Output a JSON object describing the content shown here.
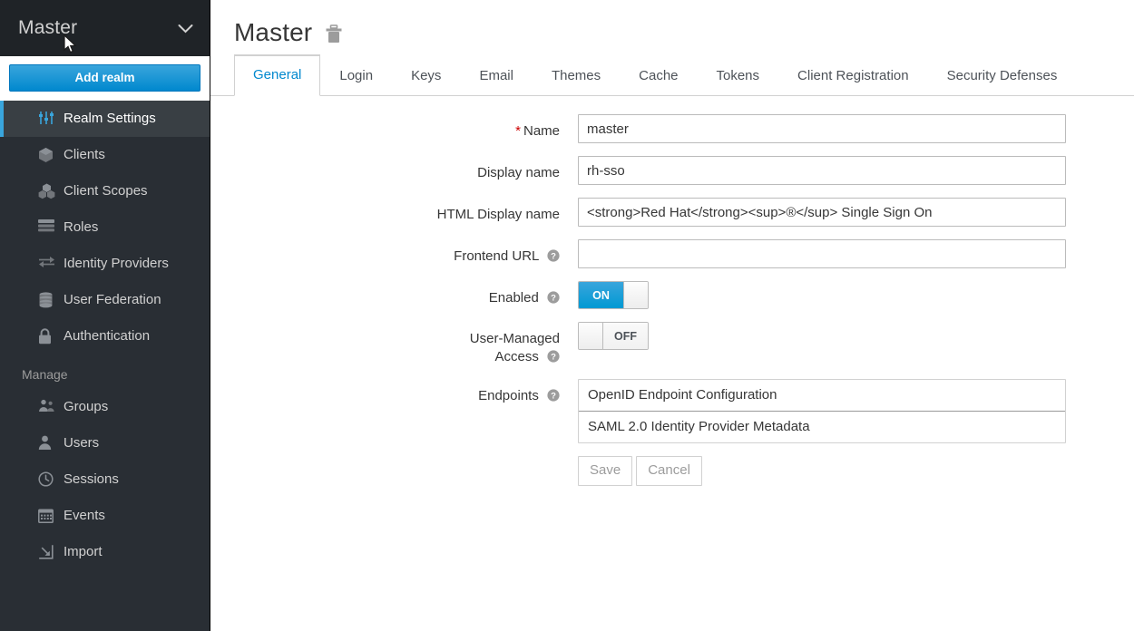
{
  "sidebar": {
    "realm_selector": {
      "label": "Master",
      "chevron_icon": "chevron-down-icon"
    },
    "add_realm_label": "Add realm",
    "items": [
      {
        "label": "Realm Settings",
        "icon": "sliders-icon",
        "active": true
      },
      {
        "label": "Clients",
        "icon": "cube-icon",
        "active": false
      },
      {
        "label": "Client Scopes",
        "icon": "cubes-icon",
        "active": false
      },
      {
        "label": "Roles",
        "icon": "list-rows-icon",
        "active": false
      },
      {
        "label": "Identity Providers",
        "icon": "exchange-arrows-icon",
        "active": false
      },
      {
        "label": "User Federation",
        "icon": "database-icon",
        "active": false
      },
      {
        "label": "Authentication",
        "icon": "lock-icon",
        "active": false
      }
    ],
    "manage_section_label": "Manage",
    "manage_items": [
      {
        "label": "Groups",
        "icon": "users-group-icon"
      },
      {
        "label": "Users",
        "icon": "user-icon"
      },
      {
        "label": "Sessions",
        "icon": "clock-icon"
      },
      {
        "label": "Events",
        "icon": "calendar-icon"
      },
      {
        "label": "Import",
        "icon": "import-arrow-icon"
      }
    ]
  },
  "header": {
    "title": "Master",
    "delete_icon": "trash-icon"
  },
  "tabs": [
    {
      "label": "General",
      "active": true
    },
    {
      "label": "Login",
      "active": false
    },
    {
      "label": "Keys",
      "active": false
    },
    {
      "label": "Email",
      "active": false
    },
    {
      "label": "Themes",
      "active": false
    },
    {
      "label": "Cache",
      "active": false
    },
    {
      "label": "Tokens",
      "active": false
    },
    {
      "label": "Client Registration",
      "active": false
    },
    {
      "label": "Security Defenses",
      "active": false
    }
  ],
  "form": {
    "name": {
      "label": "Name",
      "required_marker": "*",
      "value": "master",
      "placeholder": ""
    },
    "display_name": {
      "label": "Display name",
      "value": "rh-sso",
      "placeholder": ""
    },
    "html_display_name": {
      "label": "HTML Display name",
      "value": "<strong>Red Hat</strong><sup>®</sup> Single Sign On",
      "placeholder": ""
    },
    "frontend_url": {
      "label": "Frontend URL",
      "value": "",
      "placeholder": "",
      "help_icon": "question-circle-icon"
    },
    "enabled": {
      "label": "Enabled",
      "state": "ON",
      "help_icon": "question-circle-icon"
    },
    "user_managed_access": {
      "label_line1": "User-Managed",
      "label_line2": "Access",
      "state": "OFF",
      "help_icon": "question-circle-icon"
    },
    "endpoints": {
      "label": "Endpoints",
      "help_icon": "question-circle-icon",
      "items": [
        "OpenID Endpoint Configuration",
        "SAML 2.0 Identity Provider Metadata"
      ]
    },
    "save_label": "Save",
    "cancel_label": "Cancel"
  },
  "colors": {
    "sidebar_bg": "#292e34",
    "sidebar_active_bg": "#393f44",
    "accent_blue": "#0088ce",
    "active_border": "#39a5dc",
    "required_red": "#cc0000"
  }
}
